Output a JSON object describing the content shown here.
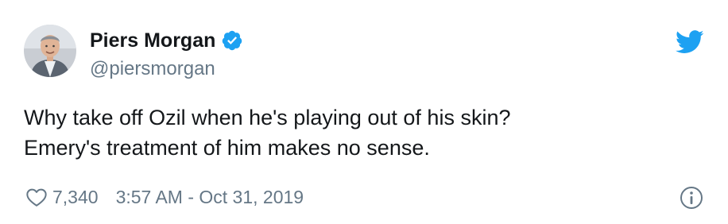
{
  "author": {
    "display_name": "Piers Morgan",
    "handle": "@piersmorgan",
    "verified": true
  },
  "tweet": {
    "lines": [
      "Why take off Ozil when he's playing out of his skin?",
      "Emery's treatment of him makes no sense."
    ]
  },
  "footer": {
    "like_count": "7,340",
    "timestamp": "3:57 AM - Oct 31, 2019"
  },
  "icons": {
    "verified": "verified-badge-icon",
    "brand": "twitter-bird-icon",
    "like": "heart-icon",
    "info": "info-icon"
  },
  "colors": {
    "twitter_blue": "#1da1f2",
    "text": "#14171a",
    "secondary": "#657786"
  }
}
